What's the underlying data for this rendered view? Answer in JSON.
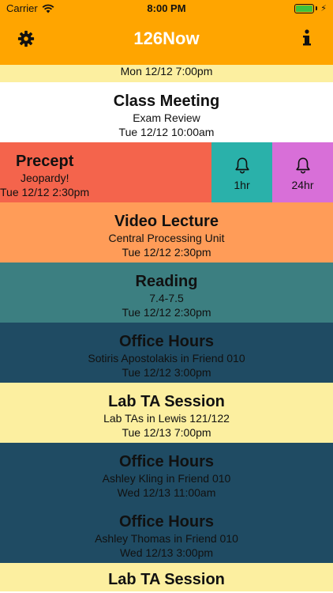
{
  "status_bar": {
    "carrier": "Carrier",
    "time": "8:00 PM"
  },
  "nav": {
    "title": "126Now"
  },
  "list": {
    "partial_top": {
      "date": "Mon 12/12 7:00pm"
    },
    "class_meeting": {
      "title": "Class Meeting",
      "subtitle": "Exam Review",
      "date": "Tue 12/12 10:00am"
    },
    "precept": {
      "title": "Precept",
      "subtitle": "Jeopardy!",
      "date": "Tue 12/12 2:30pm"
    },
    "remind_actions": {
      "one_hour": "1hr",
      "one_day": "24hr"
    },
    "video_lecture": {
      "title": "Video Lecture",
      "subtitle": "Central Processing Unit",
      "date": "Tue 12/12 2:30pm"
    },
    "reading": {
      "title": "Reading",
      "subtitle": "7.4-7.5",
      "date": "Tue 12/12 2:30pm"
    },
    "office_hours_1": {
      "title": "Office Hours",
      "subtitle": "Sotiris Apostolakis in Friend 010",
      "date": "Tue 12/12 3:00pm"
    },
    "lab_ta_1": {
      "title": "Lab TA Session",
      "subtitle": "Lab TAs in Lewis 121/122",
      "date": "Tue 12/13 7:00pm"
    },
    "office_hours_2": {
      "title": "Office Hours",
      "subtitle": "Ashley Kling in Friend 010",
      "date": "Wed 12/13 11:00am"
    },
    "office_hours_3": {
      "title": "Office Hours",
      "subtitle": "Ashley Thomas in Friend 010",
      "date": "Wed 12/13 3:00pm"
    },
    "lab_ta_2": {
      "title": "Lab TA Session"
    }
  },
  "colors": {
    "nav_bar": "#FFA500",
    "yellow": "#FCEFA0",
    "white": "#FFFFFF",
    "red": "#F4644C",
    "teal_action": "#2AB1AA",
    "magenta_action": "#D86FD8",
    "orange": "#FF9C58",
    "teal": "#3C7F81",
    "navy": "#1F4B63"
  },
  "icons": [
    "wifi-icon",
    "battery-icon",
    "gear-icon",
    "info-icon",
    "bell-icon"
  ]
}
